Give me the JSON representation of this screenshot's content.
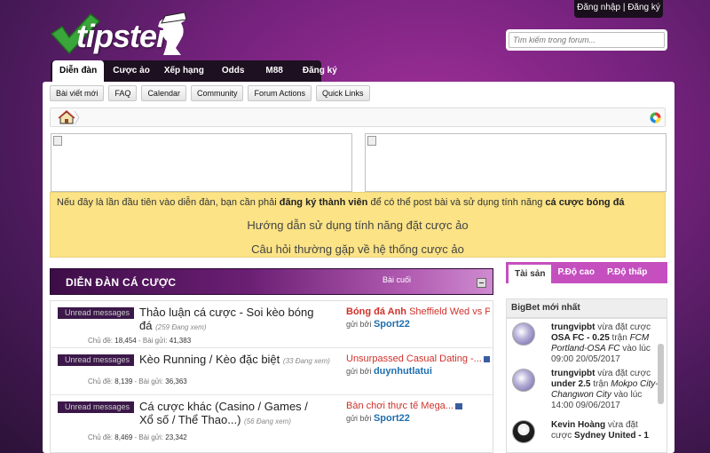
{
  "header": {
    "logo_text": "tipster",
    "auth_links": "Đăng nhập | Đăng ký",
    "search_placeholder": "Tìm kiếm trong forum..."
  },
  "nav": {
    "tabs": [
      "Diễn đàn",
      "Cược ảo",
      "Xếp hạng",
      "Odds",
      "M88",
      "Đăng ký"
    ]
  },
  "subnav": {
    "buttons": [
      "Bài viết mới",
      "FAQ",
      "Calendar",
      "Community",
      "Forum Actions",
      "Quick Links"
    ]
  },
  "notice": {
    "line1_pre": "Nếu đây là lần đầu tiên vào diễn đàn, bạn cần phải ",
    "line1_bold1": "đăng ký thành viên",
    "line1_mid": " để có thể post bài và sử dụng tính năng ",
    "line1_bold2": "cá cược bóng đá",
    "line2": "Hướng dẫn sử dụng tính năng đặt cược ảo",
    "line3": "Câu hỏi thường gặp về hệ thống cược ảo"
  },
  "forum": {
    "title": "DIỄN ĐÀN CÁ CƯỢC",
    "last_col": "Bài cuối",
    "rows": [
      {
        "unread": "Unread messages",
        "title": "Thảo luận cá cược - Soi kèo bóng đá",
        "viewers": "(259 Đang xem)",
        "stats_label1": "Chủ đề:",
        "topics": "18,454",
        "stats_label2": "- Bài gửi:",
        "posts": "41,383",
        "last_title": "Bóng đá Anh",
        "last_topic": "Sheffield Wed vs Ph",
        "by_label": "gửi bởi",
        "by_user": "Sport22"
      },
      {
        "unread": "Unread messages",
        "title": "Kèo Running / Kèo đặc biệt",
        "viewers": "(33 Đang xem)",
        "stats_label1": "Chủ đề:",
        "topics": "8,139",
        "stats_label2": "- Bài gửi:",
        "posts": "36,363",
        "last_title": "",
        "last_topic": "Unsurpassed Casual Dating -...",
        "by_label": "gửi bởi",
        "by_user": "duynhutlatui"
      },
      {
        "unread": "Unread messages",
        "title": "Cá cược khác (Casino / Games / Xổ số / Thể Thao...)",
        "viewers": "(56 Đang xem)",
        "stats_label1": "Chủ đề:",
        "topics": "8,469",
        "stats_label2": "- Bài gửi:",
        "posts": "23,342",
        "last_title": "",
        "last_topic": "Bàn chơi thực tế Mega...",
        "by_label": "gửi bởi",
        "by_user": "Sport22"
      }
    ]
  },
  "sidebar": {
    "tabs": [
      "Tài sản",
      "P.Độ cao",
      "P.Độ thấp"
    ],
    "bigbet_title": "BigBet mới nhất",
    "bets": [
      {
        "user": "trungvipbt",
        "action": " vừa đặt cược ",
        "pick": "OSA FC - 0.25",
        "on": " trận ",
        "match": "FCM Portland-OSA FC",
        "at": " vào lúc ",
        "time": "09:00 20/05/2017"
      },
      {
        "user": "trungvipbt",
        "action": " vừa đặt cược ",
        "pick": "under 2.5",
        "on": " trận ",
        "match": "Mokpo City-Changwon City",
        "at": " vào lúc ",
        "time": "14:00 09/06/2017"
      },
      {
        "user": "Kevin Hoàng",
        "action": " vừa đặt cược ",
        "pick": "Sydney United - 1",
        "on": "",
        "match": "",
        "at": "",
        "time": ""
      }
    ]
  },
  "colors": {
    "accent_purple": "#c54fbf",
    "link_red": "#d0312a",
    "link_blue": "#1f6fb0",
    "notice_yellow": "#fbe386",
    "check_green": "#3aa53a"
  }
}
